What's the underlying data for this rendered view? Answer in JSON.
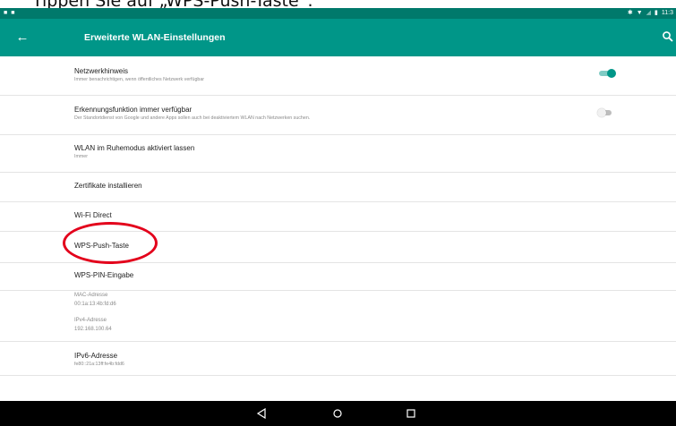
{
  "caption": "Tippen Sie auf „WPS-Push-Taste“.",
  "statusbar": {
    "time": "11:3"
  },
  "appbar": {
    "title": "Erweiterte WLAN-Einstellungen"
  },
  "settings": [
    {
      "title": "Netzwerkhinweis",
      "subtitle": "Immer benachrichtigen, wenn öffentliches Netzwerk verfügbar",
      "toggle": "on"
    },
    {
      "title": "Erkennungsfunktion immer verfügbar",
      "subtitle": "Der Standortdienst von Google und andere Apps sollen auch bei deaktiviertem WLAN nach Netzwerken suchen.",
      "toggle": "off"
    },
    {
      "title": "WLAN im Ruhemodus aktiviert lassen",
      "subtitle": "Immer"
    },
    {
      "title": "Zertifikate installieren"
    },
    {
      "title": "Wi-Fi Direct"
    },
    {
      "title": "WPS-Push-Taste"
    },
    {
      "title": "WPS-PIN-Eingabe"
    }
  ],
  "info": {
    "mac_label": "MAC-Adresse",
    "mac_value": "00:1a:13:4b:fd:d6",
    "ipv4_label": "IPv4-Adresse",
    "ipv4_value": "192.168.100.64",
    "ipv6_label": "IPv6-Adresse",
    "ipv6_value": "fe80::21a:13ff:fe4b:fdd6"
  },
  "colors": {
    "appbar": "#009688",
    "statusbar": "#00796b",
    "annotation": "#e3001b"
  },
  "icons": {
    "back": "arrow-back-icon",
    "search": "search-icon",
    "nav": [
      "nav-back-icon",
      "nav-home-icon",
      "nav-recents-icon"
    ]
  }
}
